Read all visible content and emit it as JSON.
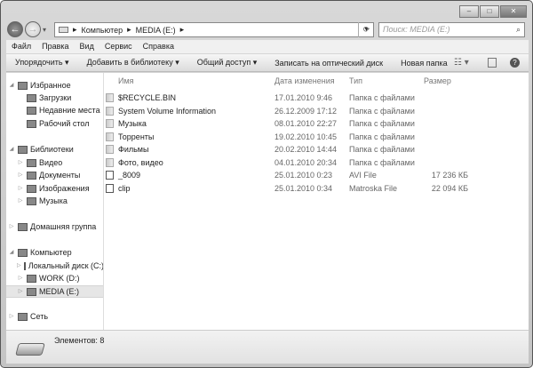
{
  "window": {
    "buttons": {
      "minimize": "–",
      "maximize": "□",
      "close": "✕"
    }
  },
  "nav": {
    "back": "←",
    "forward": "→",
    "recent": "▾"
  },
  "address": {
    "crumbs": [
      "Компьютер",
      "MEDIA (E:)"
    ],
    "sep": "▸"
  },
  "search": {
    "placeholder": "Поиск: MEDIA (E:)",
    "icon": "⌕"
  },
  "menu": [
    "Файл",
    "Правка",
    "Вид",
    "Сервис",
    "Справка"
  ],
  "toolbar": [
    "Упорядочить ▾",
    "Добавить в библиотеку ▾",
    "Общий доступ ▾",
    "Записать на оптический диск",
    "Новая папка"
  ],
  "toolbar_icons": {
    "view": "☷ ▾",
    "preview": "▯",
    "help": "?"
  },
  "sidebar": [
    {
      "label": "Избранное",
      "level": 0,
      "arrow": "◢",
      "icon": "star"
    },
    {
      "label": "Загрузки",
      "level": 1,
      "icon": "downloads"
    },
    {
      "label": "Недавние места",
      "level": 1,
      "icon": "recent"
    },
    {
      "label": "Рабочий стол",
      "level": 1,
      "icon": "desktop"
    },
    {
      "label": "Библиотеки",
      "level": 0,
      "arrow": "◢",
      "icon": "libraries"
    },
    {
      "label": "Видео",
      "level": 1,
      "arrow": "▷",
      "icon": "video"
    },
    {
      "label": "Документы",
      "level": 1,
      "arrow": "▷",
      "icon": "documents"
    },
    {
      "label": "Изображения",
      "level": 1,
      "arrow": "▷",
      "icon": "pictures"
    },
    {
      "label": "Музыка",
      "level": 1,
      "arrow": "▷",
      "icon": "music"
    },
    {
      "label": "Домашняя группа",
      "level": 0,
      "arrow": "▷",
      "icon": "homegroup"
    },
    {
      "label": "Компьютер",
      "level": 0,
      "arrow": "◢",
      "icon": "computer"
    },
    {
      "label": "Локальный диск (C:)",
      "level": 1,
      "arrow": "▷",
      "icon": "drive"
    },
    {
      "label": "WORK (D:)",
      "level": 1,
      "arrow": "▷",
      "icon": "drive"
    },
    {
      "label": "MEDIA (E:)",
      "level": 1,
      "arrow": "▷",
      "icon": "drive",
      "selected": true
    },
    {
      "label": "Сеть",
      "level": 0,
      "arrow": "▷",
      "icon": "network"
    }
  ],
  "columns": [
    "Имя",
    "Дата изменения",
    "Тип",
    "Размер"
  ],
  "files": [
    {
      "name": "$RECYCLE.BIN",
      "date": "17.01.2010 9:46",
      "type": "Папка с файлами",
      "size": "",
      "kind": "folder"
    },
    {
      "name": "System Volume Information",
      "date": "26.12.2009 17:12",
      "type": "Папка с файлами",
      "size": "",
      "kind": "folder"
    },
    {
      "name": "Музыка",
      "date": "08.01.2010 22:27",
      "type": "Папка с файлами",
      "size": "",
      "kind": "folder"
    },
    {
      "name": "Торренты",
      "date": "19.02.2010 10:45",
      "type": "Папка с файлами",
      "size": "",
      "kind": "folder"
    },
    {
      "name": "Фильмы",
      "date": "20.02.2010 14:44",
      "type": "Папка с файлами",
      "size": "",
      "kind": "folder"
    },
    {
      "name": "Фото, видео",
      "date": "04.01.2010 20:34",
      "type": "Папка с файлами",
      "size": "",
      "kind": "folder"
    },
    {
      "name": "_8009",
      "date": "25.01.2010 0:23",
      "type": "AVI File",
      "size": "17 236 КБ",
      "kind": "file"
    },
    {
      "name": "clip",
      "date": "25.01.2010 0:34",
      "type": "Matroska File",
      "size": "22 094 КБ",
      "kind": "file"
    }
  ],
  "status": {
    "count": "Элементов: 8"
  }
}
